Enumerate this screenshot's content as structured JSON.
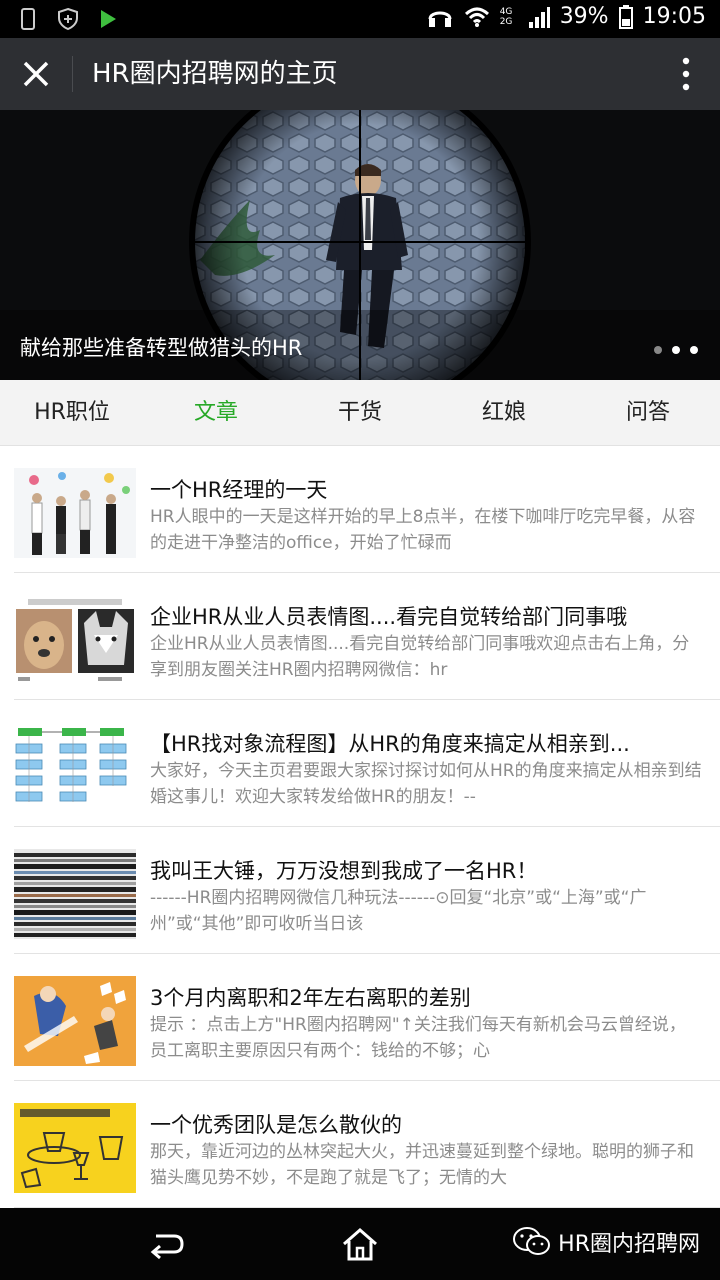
{
  "status_bar": {
    "network": "4G 2G",
    "battery": "39%",
    "time": "19:05"
  },
  "header": {
    "title": "HR圈内招聘网的主页"
  },
  "banner": {
    "caption": "献给那些准备转型做猎头的HR"
  },
  "tabs": [
    {
      "label": "HR职位"
    },
    {
      "label": "文章"
    },
    {
      "label": "干货"
    },
    {
      "label": "红娘"
    },
    {
      "label": "问答"
    }
  ],
  "articles": [
    {
      "title": "一个HR经理的一天",
      "summary": "HR人眼中的一天是这样开始的早上8点半，在楼下咖啡厅吃完早餐，从容的走进干净整洁的office，开始了忙碌而"
    },
    {
      "title": "企业HR从业人员表情图....看完自觉转给部门同事哦",
      "summary": "企业HR从业人员表情图....看完自觉转给部门同事哦欢迎点击右上角，分享到朋友圈关注HR圈内招聘网微信：hr"
    },
    {
      "title": "【HR找对象流程图】从HR的角度来搞定从相亲到...",
      "summary": "大家好，今天主页君要跟大家探讨探讨如何从HR的角度来搞定从相亲到结婚这事儿！欢迎大家转发给做HR的朋友！--"
    },
    {
      "title": "我叫王大锤，万万没想到我成了一名HR！",
      "summary": "------HR圈内招聘网微信几种玩法------⊙回复“北京”或“上海”或“广州”或“其他”即可收听当日该"
    },
    {
      "title": "3个月内离职和2年左右离职的差别",
      "summary": "提示 ：点击上方\"HR圈内招聘网\"↑关注我们每天有新机会马云曾经说，员工离职主要原因只有两个：钱给的不够；心"
    },
    {
      "title": "一个优秀团队是怎么散伙的",
      "summary": "那天，靠近河边的丛林突起大火，并迅速蔓延到整个绿地。聪明的狮子和猫头鹰见势不妙，不是跑了就是飞了；无情的大"
    }
  ],
  "watermark": {
    "text": "HR圈内招聘网"
  },
  "colors": {
    "accent": "#27a927",
    "header_bg": "#2d2f33"
  }
}
